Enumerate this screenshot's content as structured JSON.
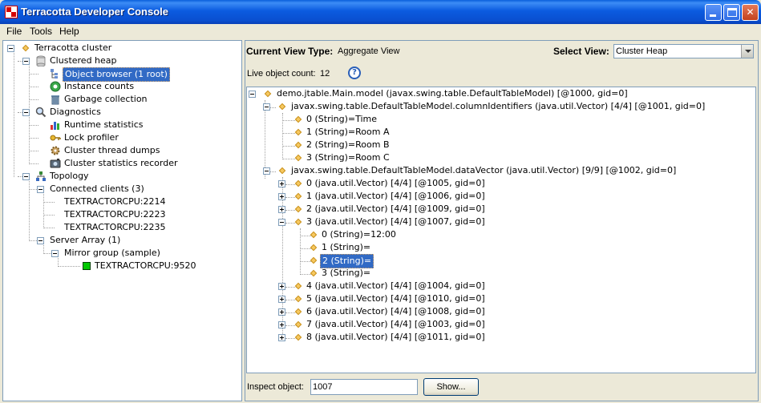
{
  "window": {
    "title": "Terracotta Developer Console",
    "controls": [
      "minimize-icon",
      "maximize-icon",
      "close-icon"
    ]
  },
  "menubar": {
    "items": [
      "File",
      "Tools",
      "Help"
    ]
  },
  "nav_tree": {
    "root": "Terracotta cluster",
    "items": [
      {
        "label": "Clustered heap",
        "icon": "database-icon"
      },
      {
        "label": "Object browser (1 root)",
        "icon": "object-browser-icon",
        "selected": true
      },
      {
        "label": "Instance counts",
        "icon": "counter-icon"
      },
      {
        "label": "Garbage collection",
        "icon": "trash-icon"
      },
      {
        "label": "Diagnostics",
        "icon": "magnifier-icon"
      },
      {
        "label": "Runtime statistics",
        "icon": "bar-chart-icon"
      },
      {
        "label": "Lock profiler",
        "icon": "key-icon"
      },
      {
        "label": "Cluster thread dumps",
        "icon": "gear-icon"
      },
      {
        "label": "Cluster statistics recorder",
        "icon": "camera-icon"
      },
      {
        "label": "Topology",
        "icon": "topology-icon"
      },
      {
        "label": "Connected clients (3)",
        "icon": ""
      },
      {
        "label": "TEXTRACTORCPU:2214",
        "icon": ""
      },
      {
        "label": "TEXTRACTORCPU:2223",
        "icon": ""
      },
      {
        "label": "TEXTRACTORCPU:2235",
        "icon": ""
      },
      {
        "label": "Server Array (1)",
        "icon": ""
      },
      {
        "label": "Mirror group (sample)",
        "icon": ""
      },
      {
        "label": "TEXTRACTORCPU:9520",
        "icon": "server-status-icon",
        "status_color": "#00c800"
      }
    ]
  },
  "main": {
    "view_type_label": "Current View Type:",
    "view_type_value": "Aggregate View",
    "select_view_label": "Select View:",
    "select_view_value": "Cluster Heap",
    "live_count_label": "Live object count:",
    "live_count_value": "12",
    "object_tree": [
      "demo.jtable.Main.model (javax.swing.table.DefaultTableModel) [@1000, gid=0]",
      "javax.swing.table.DefaultTableModel.columnIdentifiers (java.util.Vector) [4/4] [@1001, gid=0]",
      "0 (String)=Time",
      "1 (String)=Room A",
      "2 (String)=Room B",
      "3 (String)=Room C",
      "javax.swing.table.DefaultTableModel.dataVector (java.util.Vector) [9/9] [@1002, gid=0]",
      "0 (java.util.Vector) [4/4] [@1005, gid=0]",
      "1 (java.util.Vector) [4/4] [@1006, gid=0]",
      "2 (java.util.Vector) [4/4] [@1009, gid=0]",
      "3 (java.util.Vector) [4/4] [@1007, gid=0]",
      "0 (String)=12:00",
      "1 (String)=",
      "2 (String)=",
      "3 (String)=",
      "4 (java.util.Vector) [4/4] [@1004, gid=0]",
      "5 (java.util.Vector) [4/4] [@1010, gid=0]",
      "6 (java.util.Vector) [4/4] [@1008, gid=0]",
      "7 (java.util.Vector) [4/4] [@1003, gid=0]",
      "8 (java.util.Vector) [4/4] [@1011, gid=0]"
    ],
    "inspect_label": "Inspect object:",
    "inspect_value": "1007",
    "show_button": "Show..."
  }
}
